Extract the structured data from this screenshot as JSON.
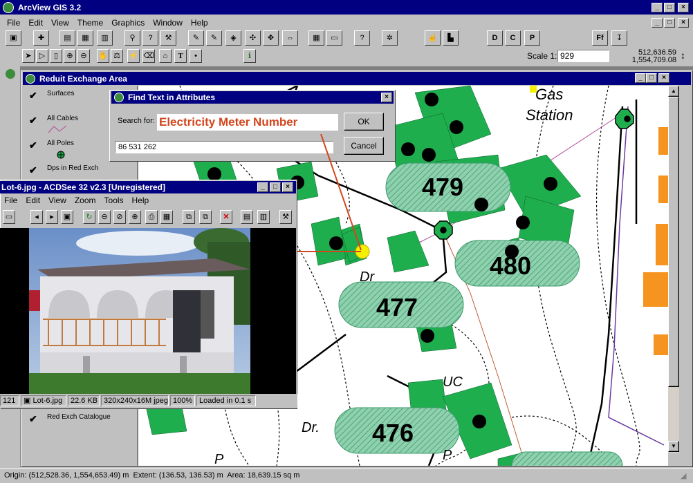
{
  "app": {
    "title": "ArcView GIS 3.2",
    "menu": [
      "File",
      "Edit",
      "View",
      "Theme",
      "Graphics",
      "Window",
      "Help"
    ],
    "scale_label": "Scale 1:",
    "scale_value": "929",
    "coord_x": "512,636.59",
    "coord_y": "1,554,709.08",
    "letter_buttons": [
      "D",
      "C",
      "P"
    ],
    "ff_label": "Ff"
  },
  "view_window": {
    "title": "Reduit Exchange Area",
    "legend": [
      "Surfaces",
      "All Cables",
      "All Poles",
      "Dps in Red Exch",
      "Red Exch Catalogue"
    ],
    "parcels": [
      "479",
      "480",
      "477",
      "476"
    ],
    "street_labels": [
      "Gas",
      "Station",
      "Dr",
      "UC",
      "Dr.",
      "P",
      "P"
    ]
  },
  "find_dialog": {
    "title": "Find Text in Attributes",
    "search_label": "Search for:",
    "search_value": "86 531 262",
    "ok_label": "OK",
    "cancel_label": "Cancel"
  },
  "annotation": {
    "text": "Electricity Meter Number",
    "color": "#d2461e"
  },
  "acdsee": {
    "title": "Lot-6.jpg - ACDSee 32 v2.3 [Unregistered]",
    "menu": [
      "File",
      "Edit",
      "View",
      "Zoom",
      "Tools",
      "Help"
    ],
    "status": [
      "121",
      "Lot-6.jpg",
      "22.6 KB",
      "320x240x16M jpeg",
      "100%",
      "Loaded in 0.1 s"
    ]
  },
  "status_bar": {
    "text": "Origin: (512,528.36, 1,554,653.49) m  Extent: (136.53, 136.53) m  Area: 18,639.15 sq m"
  },
  "colors": {
    "title_active": "#000080",
    "parcel_green": "#1fae4e",
    "hatch_green": "#7fc9a3"
  }
}
